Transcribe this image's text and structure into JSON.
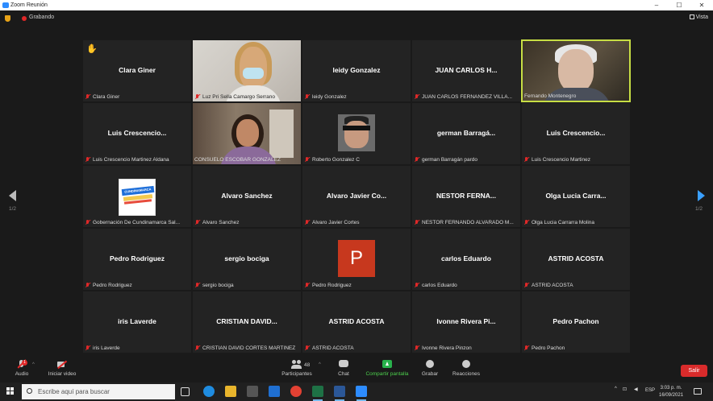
{
  "window": {
    "title": "Zoom Reunión",
    "controls": [
      "–",
      "☐",
      "✕"
    ]
  },
  "status": {
    "recording_label": "Grabando",
    "view_label": "Vista"
  },
  "participants": [
    {
      "name": "Clara Giner",
      "label": "Clara Giner",
      "type": "name",
      "hand_raised": true
    },
    {
      "name": "",
      "label": "Luz Pri Sella Camargo Serrano",
      "type": "video"
    },
    {
      "name": "leidy Gonzalez",
      "label": "leidy Gonzalez",
      "type": "name"
    },
    {
      "name": "JUAN CARLOS H...",
      "label": "JUAN CARLOS FERNANDEZ VILLA...",
      "type": "name"
    },
    {
      "name": "",
      "label": "Fernando Montenegro",
      "type": "video",
      "speaking": true
    },
    {
      "name": "Luis Crescencio...",
      "label": "Luis Crescencio Martinez Aldana",
      "type": "name"
    },
    {
      "name": "",
      "label": "CONSUELO ESCOBAR GONZALEZ",
      "type": "video"
    },
    {
      "name": "",
      "label": "Roberto Gonzalez C",
      "type": "photo"
    },
    {
      "name": "german Barragá...",
      "label": "german Barragán pardo",
      "type": "name"
    },
    {
      "name": "Luis Crescencio...",
      "label": "Luis Crescencio Martinez",
      "type": "name"
    },
    {
      "name": "",
      "label": "Gobernación De Cundinamarca Sal...",
      "type": "logo"
    },
    {
      "name": "Alvaro Sanchez",
      "label": "Alvaro Sanchez",
      "type": "name"
    },
    {
      "name": "Alvaro Javier Co...",
      "label": "Alvaro Javier Cortes",
      "type": "name"
    },
    {
      "name": "NESTOR FERNA...",
      "label": "NESTOR FERNANDO ALVARADO M...",
      "type": "name"
    },
    {
      "name": "Olga Lucia Carra...",
      "label": "Olga Lucia Carrarra Molina",
      "type": "name"
    },
    {
      "name": "Pedro Rodriguez",
      "label": "Pedro Rodriguez",
      "type": "name"
    },
    {
      "name": "sergio bociga",
      "label": "sergio bociga",
      "type": "name"
    },
    {
      "name": "P",
      "label": "Pedro Rodriguez",
      "type": "avatar"
    },
    {
      "name": "carlos Eduardo",
      "label": "carlos Eduardo",
      "type": "name"
    },
    {
      "name": "ASTRID ACOSTA",
      "label": "ASTRID ACOSTA",
      "type": "name"
    },
    {
      "name": "iris Laverde",
      "label": "iris Laverde",
      "type": "name"
    },
    {
      "name": "CRISTIAN DAVID...",
      "label": "CRISTIAN DAVID CORTES MARTINEZ",
      "type": "name"
    },
    {
      "name": "ASTRID ACOSTA",
      "label": "ASTRID ACOSTA",
      "type": "name"
    },
    {
      "name": "Ivonne Rivera Pi...",
      "label": "Ivonne Rivera Pinzon",
      "type": "name"
    },
    {
      "name": "Pedro Pachon",
      "label": "Pedro Pachon",
      "type": "name"
    }
  ],
  "pagination": {
    "left": "1/2",
    "right": "1/2"
  },
  "avatar_logo_text": "CUNDINAMARCA",
  "toolbar": {
    "audio": "Audio",
    "video": "Iniciar video",
    "participants": "Participantes",
    "participants_count": "48",
    "chat": "Chat",
    "share": "Compartir pantalla",
    "record": "Grabar",
    "reactions": "Reacciones",
    "leave": "Salir",
    "audio_badge": "1"
  },
  "taskbar": {
    "search_placeholder": "Escribe aquí para buscar",
    "language": "ESP",
    "time": "3:03 p. m.",
    "date": "16/09/2021"
  },
  "colors": {
    "speaker_border": "#c7de44",
    "muted": "#e02828",
    "share": "#28b14c",
    "leave": "#d92b2b",
    "accent": "#2d8cff"
  }
}
